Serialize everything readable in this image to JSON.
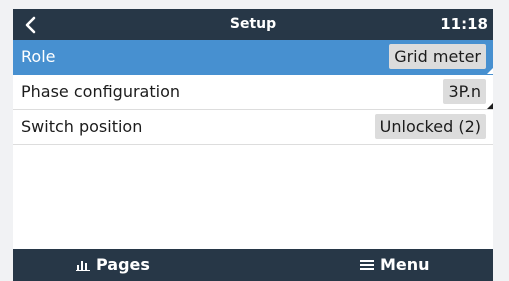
{
  "header": {
    "title": "Setup",
    "clock": "11:18"
  },
  "rows": [
    {
      "label": "Role",
      "value": "Grid meter"
    },
    {
      "label": "Phase configuration",
      "value": "3P.n"
    },
    {
      "label": "Switch position",
      "value": "Unlocked (2)"
    }
  ],
  "footer": {
    "pages_label": "Pages",
    "menu_label": "Menu"
  },
  "icons": {
    "back": "chevron-left-icon",
    "pages": "bar-chart-icon",
    "menu": "hamburger-menu-icon"
  },
  "colors": {
    "header_bg": "#273747",
    "selected_row": "#4790d0",
    "value_bg": "#dcdcdc"
  }
}
